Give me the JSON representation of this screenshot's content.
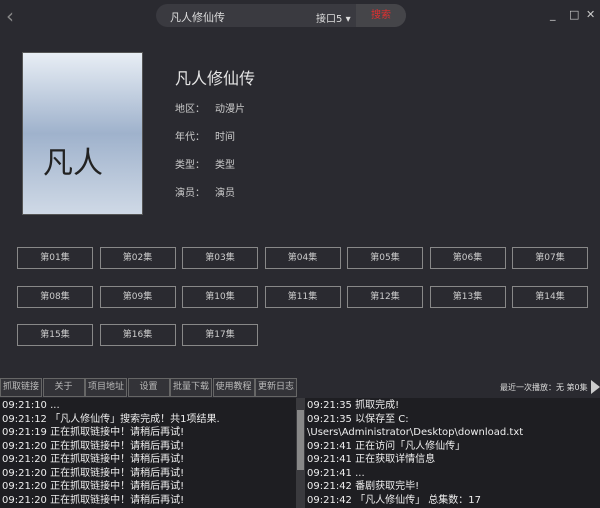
{
  "header": {
    "search_value": "凡人修仙传",
    "interface": "接口5",
    "search_label": "搜索"
  },
  "detail": {
    "title": "凡人修仙传",
    "poster_text": "凡人",
    "rows": [
      {
        "label": "地区：",
        "value": "动漫片"
      },
      {
        "label": "年代：",
        "value": "时间"
      },
      {
        "label": "类型：",
        "value": "类型"
      },
      {
        "label": "演员：",
        "value": "演员"
      }
    ]
  },
  "episodes": [
    "第01集",
    "第02集",
    "第03集",
    "第04集",
    "第05集",
    "第06集",
    "第07集",
    "第08集",
    "第09集",
    "第10集",
    "第11集",
    "第12集",
    "第13集",
    "第14集",
    "第15集",
    "第16集",
    "第17集"
  ],
  "toolbar": [
    "抓取链接",
    "关于",
    "项目地址",
    "设置",
    "批量下载",
    "使用教程",
    "更新日志"
  ],
  "status": "最近一次播放：无  第0集",
  "log_left": [
    "09:21:10 ...",
    "09:21:12 「凡人修仙传」搜索完成！共1项结果.",
    "09:21:19 正在抓取链接中！请稍后再试!",
    "09:21:20 正在抓取链接中！请稍后再试!",
    "09:21:20 正在抓取链接中！请稍后再试!",
    "09:21:20 正在抓取链接中！请稍后再试!",
    "09:21:20 正在抓取链接中！请稍后再试!",
    "09:21:20 正在抓取链接中！请稍后再试!"
  ],
  "log_right": [
    "09:21:35 抓取完成!",
    "09:21:35 以保存至 C:",
    "\\Users\\Administrator\\Desktop\\download.txt",
    "09:21:41 正在访问「凡人修仙传」",
    "09:21:41 正在获取详情信息",
    "09:21:41 ...",
    "09:21:42 番剧获取完毕!",
    "09:21:42 「凡人修仙传」 总集数：17"
  ]
}
